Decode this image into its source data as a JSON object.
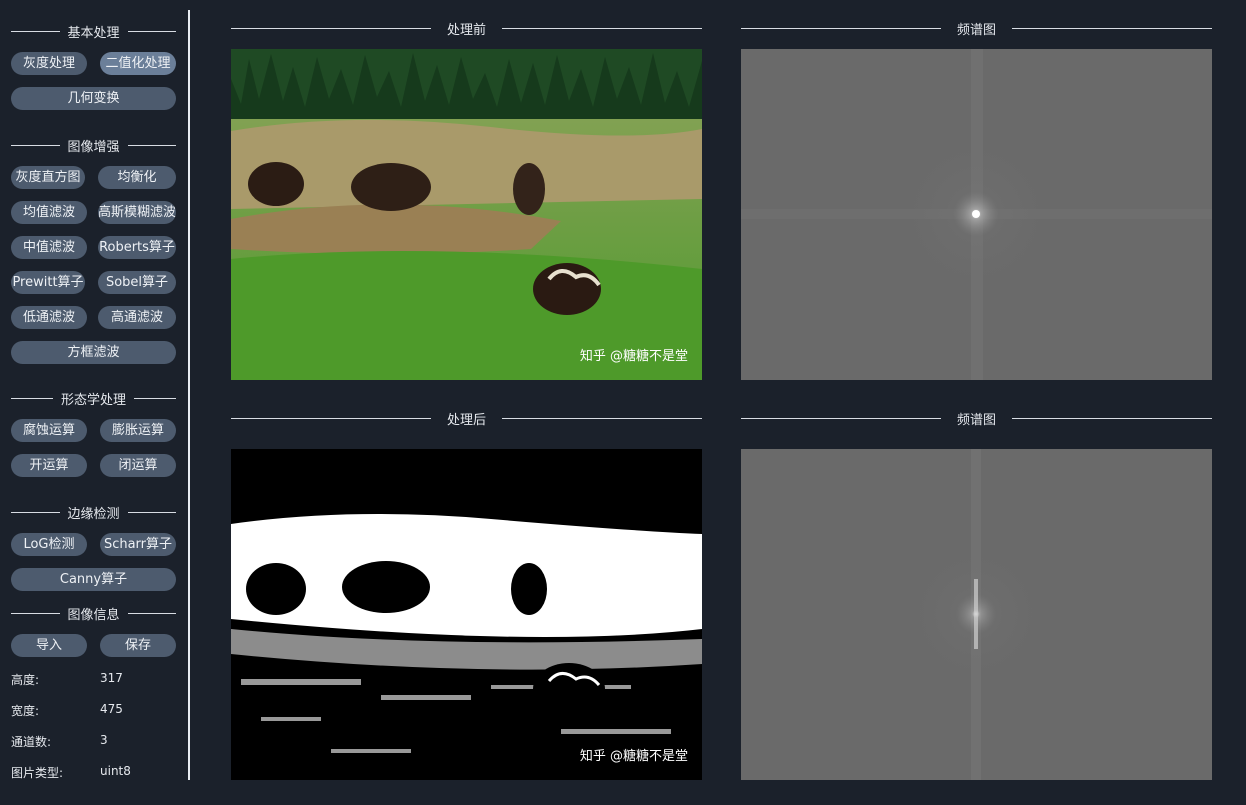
{
  "sidebar": {
    "basic": {
      "title": "基本处理",
      "buttons": [
        "灰度处理",
        "二值化处理",
        "几何变换"
      ]
    },
    "enhance": {
      "title": "图像增强",
      "buttons": [
        "灰度直方图",
        "均衡化",
        "均值滤波",
        "高斯模糊滤波",
        "中值滤波",
        "Roberts算子",
        "Prewitt算子",
        "Sobel算子",
        "低通滤波",
        "高通滤波",
        "方框滤波"
      ]
    },
    "morph": {
      "title": "形态学处理",
      "buttons": [
        "腐蚀运算",
        "膨胀运算",
        "开运算",
        "闭运算"
      ]
    },
    "edge": {
      "title": "边缘检测",
      "buttons": [
        "LoG检测",
        "Scharr算子",
        "Canny算子"
      ]
    },
    "info": {
      "title": "图像信息",
      "buttons": [
        "导入",
        "保存"
      ],
      "fields": [
        {
          "label": "高度:",
          "value": "317"
        },
        {
          "label": "宽度:",
          "value": "475"
        },
        {
          "label": "通道数:",
          "value": "3"
        },
        {
          "label": "图片类型:",
          "value": "uint8"
        }
      ]
    }
  },
  "panels": {
    "before": {
      "title": "处理前",
      "watermark": "知乎 @糖糖不是堂"
    },
    "before_spectrum": {
      "title": "频谱图"
    },
    "after": {
      "title": "处理后",
      "watermark": "知乎 @糖糖不是堂"
    },
    "after_spectrum": {
      "title": "频谱图"
    }
  },
  "colors": {
    "background": "#1b212b",
    "button": "#4d5b6e",
    "button_active": "#6b7f99"
  }
}
